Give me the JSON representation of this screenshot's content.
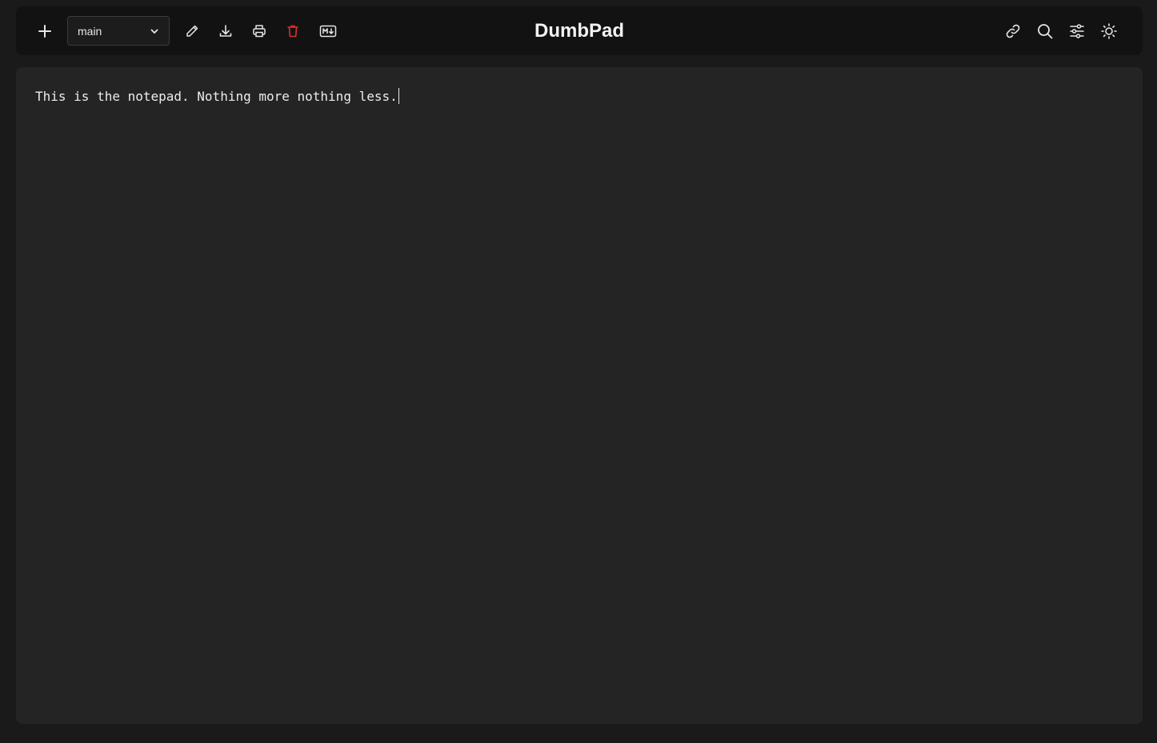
{
  "header": {
    "title": "DumbPad",
    "notepad_select": {
      "selected": "main"
    },
    "left_icons": [
      "plus-icon",
      "pencil-icon",
      "download-icon",
      "printer-icon",
      "trash-icon",
      "markdown-icon"
    ],
    "right_icons": [
      "link-icon",
      "search-icon",
      "settings-sliders-icon",
      "sun-icon"
    ],
    "colors": {
      "delete_icon": "#e0302d",
      "header_bg": "#121212",
      "editor_bg": "#242424",
      "page_bg": "#1a1a1a"
    }
  },
  "editor": {
    "content": "This is the notepad. Nothing more nothing less."
  }
}
